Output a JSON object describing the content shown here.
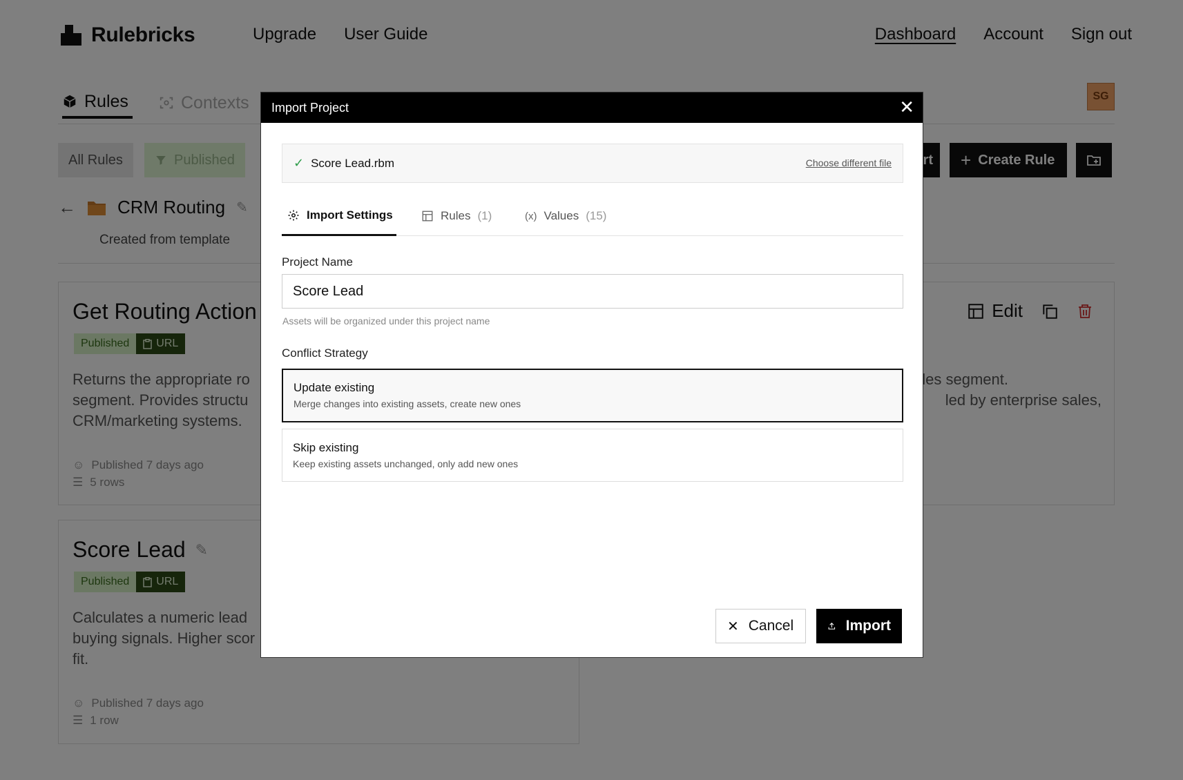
{
  "app": {
    "brand": "Rulebricks",
    "nav_left": [
      "Upgrade",
      "User Guide"
    ],
    "nav_right": [
      "Dashboard",
      "Account",
      "Sign out"
    ],
    "tabs": [
      "Rules",
      "Contexts"
    ],
    "avatar": "SG",
    "filters": {
      "all": "All Rules",
      "published": "Published"
    },
    "create_rule": "Create Rule",
    "import_partial": "rt",
    "folder": {
      "name": "CRM Routing",
      "subtitle": "Created from template"
    },
    "cards": [
      {
        "title": "Get Routing Action",
        "badge": "Published",
        "url": "URL",
        "desc_line1": "Returns the appropriate ro",
        "desc_line2": "segment. Provides structu",
        "desc_line3": "CRM/marketing systems.",
        "desc_right1": "sales segment.",
        "desc_right2": "led by enterprise sales,",
        "published": "Published 7 days ago",
        "rows": "5 rows",
        "edit": "Edit"
      },
      {
        "title": "Score Lead",
        "badge": "Published",
        "url": "URL",
        "desc_line1": "Calculates a numeric lead",
        "desc_line2": "buying signals. Higher scor",
        "desc_line3": "fit.",
        "published": "Published 7 days ago",
        "rows": "1 row"
      }
    ]
  },
  "modal": {
    "title": "Import Project",
    "file_name": "Score Lead.rbm",
    "change_file": "Choose different file",
    "tabs": [
      {
        "label": "Import Settings",
        "count": ""
      },
      {
        "label": "Rules",
        "count": "(1)"
      },
      {
        "label": "Values",
        "count": "(15)"
      }
    ],
    "project_name_label": "Project Name",
    "project_name_value": "Score Lead",
    "project_name_help": "Assets will be organized under this project name",
    "conflict_label": "Conflict Strategy",
    "options": [
      {
        "title": "Update existing",
        "desc": "Merge changes into existing assets, create new ones",
        "selected": true
      },
      {
        "title": "Skip existing",
        "desc": "Keep existing assets unchanged, only add new ones",
        "selected": false
      }
    ],
    "cancel": "Cancel",
    "import": "Import"
  },
  "colors": {
    "overlay": "rgba(0,0,0,0.5)",
    "published_bg": "#d7f0c6",
    "url_bg": "#2d4b16",
    "delete_red": "#d32f2f",
    "success_green": "#2e9c4a"
  }
}
